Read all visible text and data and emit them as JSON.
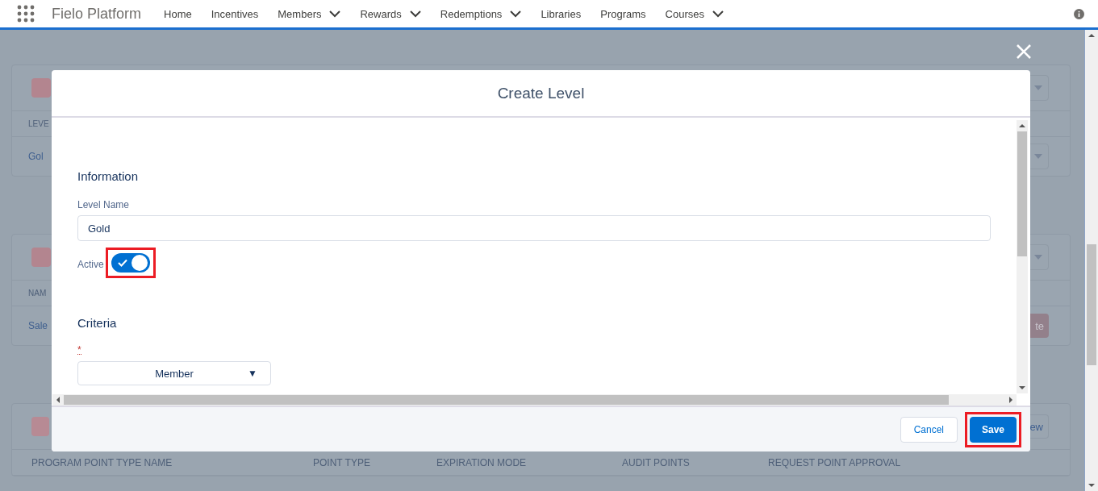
{
  "nav": {
    "app_name": "Fielo Platform",
    "items": [
      {
        "label": "Home",
        "has_menu": false
      },
      {
        "label": "Incentives",
        "has_menu": false
      },
      {
        "label": "Members",
        "has_menu": true
      },
      {
        "label": "Rewards",
        "has_menu": true
      },
      {
        "label": "Redemptions",
        "has_menu": true
      },
      {
        "label": "Libraries",
        "has_menu": false
      },
      {
        "label": "Programs",
        "has_menu": false
      },
      {
        "label": "Courses",
        "has_menu": true
      }
    ]
  },
  "background_cards": [
    {
      "column_header": "LEVE",
      "row_text": "Gol"
    },
    {
      "column_header": "NAM",
      "row_text": "Sale",
      "row_button": "te"
    }
  ],
  "points_card": {
    "header_button": "ew",
    "columns": [
      "PROGRAM POINT TYPE NAME",
      "POINT TYPE",
      "EXPIRATION MODE",
      "AUDIT POINTS",
      "REQUEST POINT APPROVAL"
    ]
  },
  "modal": {
    "title": "Create Level",
    "sections": [
      {
        "title": "Information"
      },
      {
        "title": "Criteria"
      }
    ],
    "level_name": {
      "label": "Level Name",
      "value": "Gold"
    },
    "active": {
      "label": "Active",
      "on": true,
      "highlighted": true
    },
    "criteria_field": {
      "required_mark": "*",
      "value": "Member",
      "caret": "▼"
    },
    "buttons": [
      {
        "label": "Cancel",
        "kind": "neutral",
        "highlighted": false
      },
      {
        "label": "Save",
        "kind": "brand",
        "highlighted": true
      }
    ]
  }
}
